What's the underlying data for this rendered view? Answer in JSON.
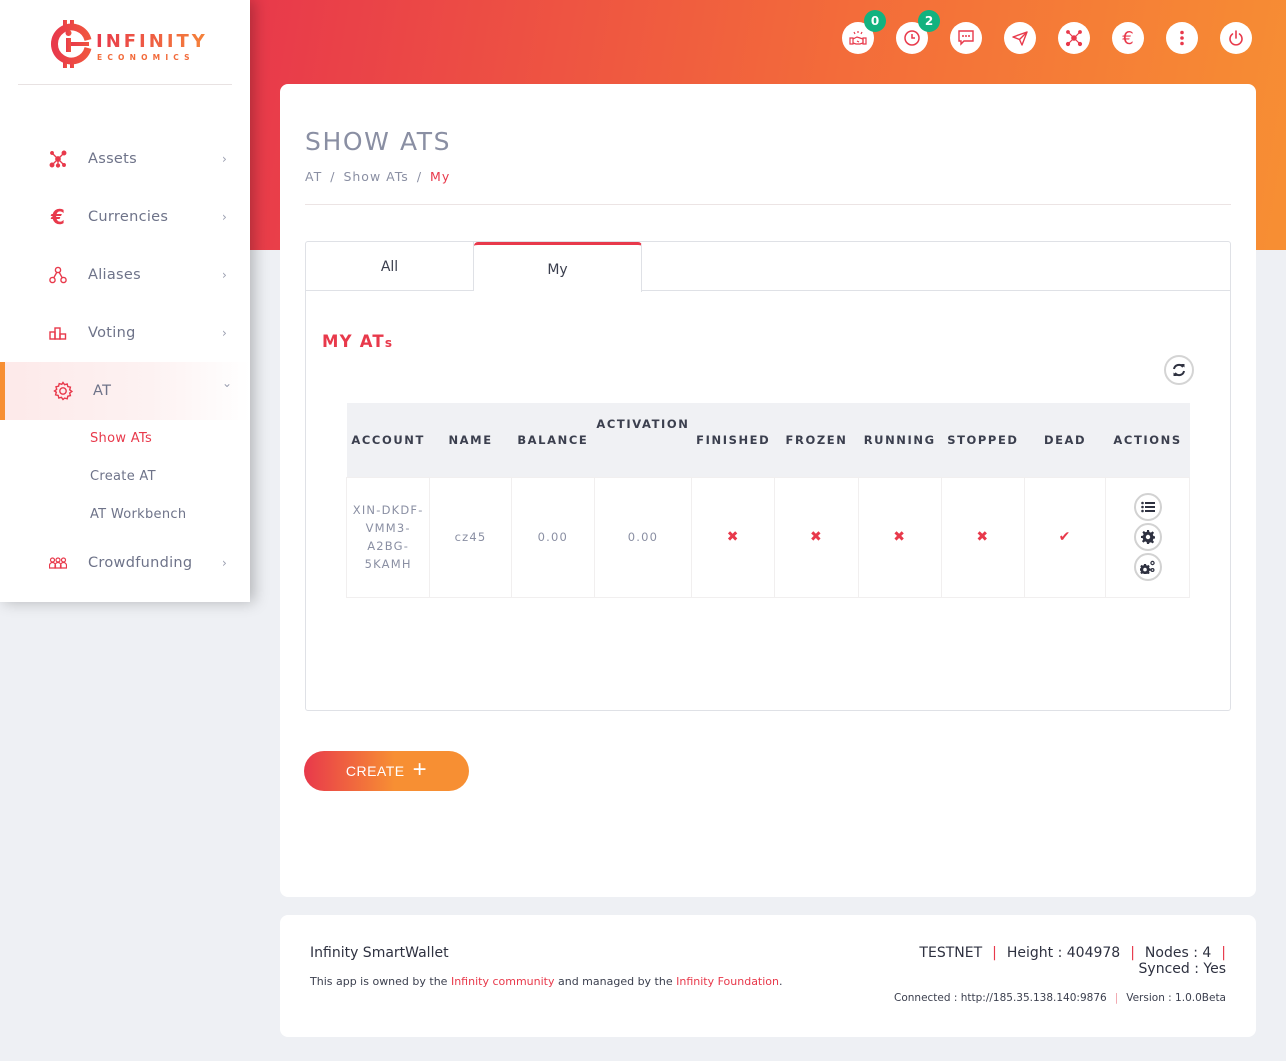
{
  "app": {
    "logo_primary": "INFINITY",
    "logo_secondary": "ECONOMICS",
    "brand_gradient": [
      "#e8394b",
      "#f78f33"
    ],
    "accent_color": "#e8394b"
  },
  "header": {
    "icons": [
      {
        "name": "handshake-icon",
        "badge": "0"
      },
      {
        "name": "clock-icon",
        "badge": "2"
      },
      {
        "name": "chat-icon"
      },
      {
        "name": "send-icon"
      },
      {
        "name": "network-icon"
      },
      {
        "name": "euro-icon"
      },
      {
        "name": "more-vertical-icon"
      },
      {
        "name": "power-icon"
      }
    ]
  },
  "sidebar": {
    "items": [
      {
        "label": "Assets",
        "icon": "network-icon",
        "chevron": "›"
      },
      {
        "label": "Currencies",
        "icon": "euro-icon",
        "chevron": "›"
      },
      {
        "label": "Aliases",
        "icon": "alias-icon",
        "chevron": "›"
      },
      {
        "label": "Voting",
        "icon": "podium-icon",
        "chevron": "›"
      },
      {
        "label": "AT",
        "icon": "gear-icon",
        "chevron": "⌄",
        "active": true,
        "children": [
          {
            "label": "Show ATs",
            "active": true
          },
          {
            "label": "Create AT"
          },
          {
            "label": "AT Workbench"
          }
        ]
      },
      {
        "label": "Crowdfunding",
        "icon": "people-icon",
        "chevron": "›"
      }
    ]
  },
  "page": {
    "title": "SHOW ATS",
    "breadcrumb": [
      "AT",
      "Show ATs",
      "My"
    ],
    "breadcrumb_separator": "/",
    "tabs": [
      {
        "label": "All",
        "active": false
      },
      {
        "label": "My",
        "active": true
      }
    ],
    "section_title_main": "MY AT",
    "section_title_suffix": "s",
    "table": {
      "columns": [
        "ACCOUNT",
        "NAME",
        "BALANCE",
        "ACTIVATION",
        "FINISHED",
        "FROZEN",
        "RUNNING",
        "STOPPED",
        "DEAD",
        "ACTIONS"
      ],
      "rows": [
        {
          "account": "XIN-DKDF-VMM3-A2BG-5KAMH",
          "account_lines": [
            "XIN-DKDF-",
            "VMM3-",
            "A2BG-",
            "5KAMH"
          ],
          "name": "cz45",
          "balance": "0.00",
          "activation": "0.00",
          "finished": false,
          "frozen": false,
          "running": false,
          "stopped": false,
          "dead": true,
          "actions": [
            "list-icon",
            "gear-icon",
            "gears-icon"
          ]
        }
      ]
    },
    "marks": {
      "yes": "✔",
      "no": "✖"
    },
    "create_button": "CREATE",
    "create_button_icon": "+"
  },
  "footer": {
    "title": "Infinity SmartWallet",
    "text_before": "This app is owned by the ",
    "link1": "Infinity community",
    "text_middle": " and managed by the ",
    "link2": "Infinity Foundation",
    "text_after": ".",
    "network": "TESTNET",
    "height": "Height : 404978",
    "nodes": "Nodes : 4",
    "synced": "Synced : Yes",
    "connected": "Connected : http://185.35.138.140:9876",
    "version": "Version : 1.0.0Beta",
    "separator": "|"
  }
}
